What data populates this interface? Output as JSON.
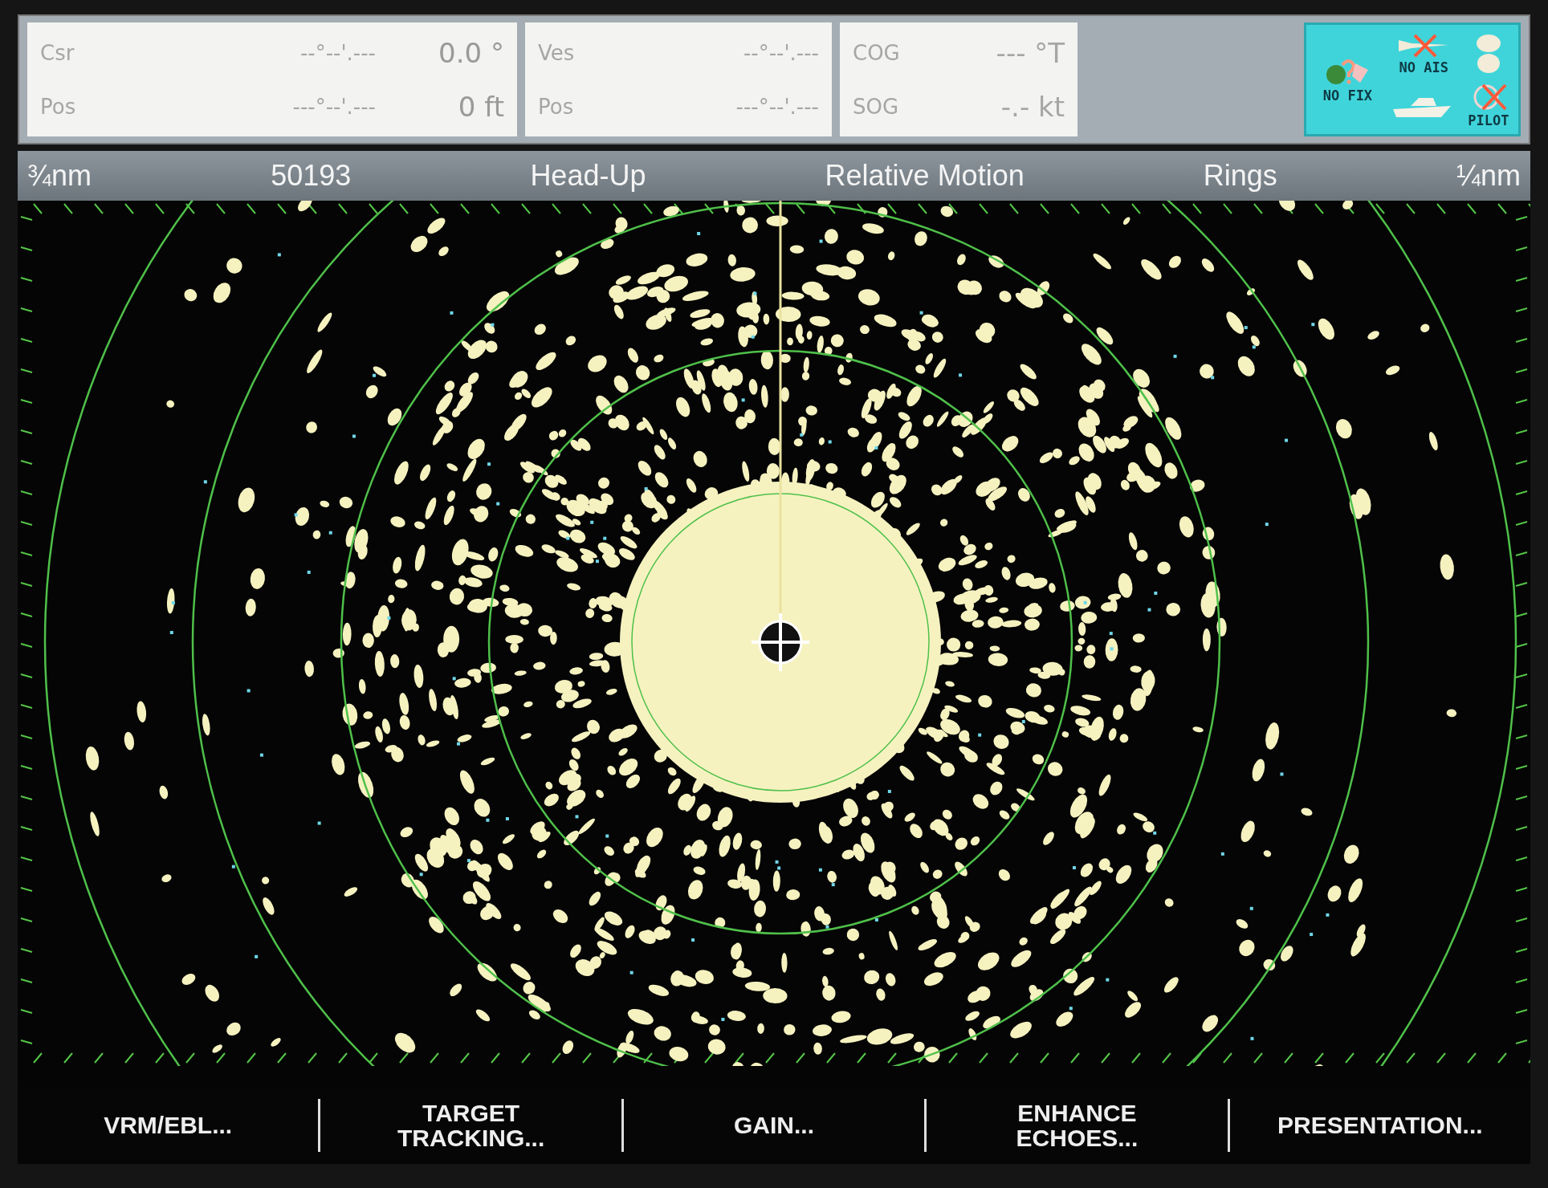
{
  "cursor_panel": {
    "rows": [
      {
        "label": "Csr",
        "position": "--°--'.---",
        "value": "0.0 °"
      },
      {
        "label": "Pos",
        "position": "---°--'.---",
        "value": "0 ft"
      }
    ]
  },
  "vessel_panel": {
    "rows": [
      {
        "label": "Ves",
        "position": "--°--'.---"
      },
      {
        "label": "Pos",
        "position": "---°--'.---"
      }
    ]
  },
  "course_panel": {
    "rows": [
      {
        "label": "COG",
        "value": "--- °T"
      },
      {
        "label": "SOG",
        "value": "-.- kt"
      }
    ]
  },
  "status_icons": {
    "fix": "NO FIX",
    "ais": "NO AIS",
    "pilot": "PILOT"
  },
  "status_bar": [
    "¾nm",
    "50193",
    "Head-Up",
    "Relative Motion",
    "Rings",
    "¼nm"
  ],
  "softkeys": [
    {
      "lines": [
        "VRM/EBL..."
      ]
    },
    {
      "lines": [
        "TARGET",
        "TRACKING..."
      ]
    },
    {
      "lines": [
        "GAIN..."
      ]
    },
    {
      "lines": [
        "ENHANCE",
        "ECHOES..."
      ]
    },
    {
      "lines": [
        "PRESENTATION..."
      ]
    }
  ]
}
